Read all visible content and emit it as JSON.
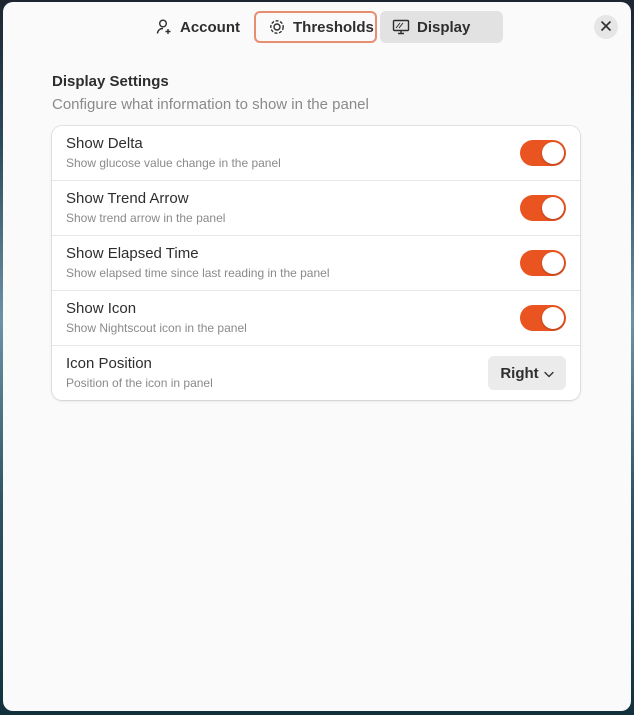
{
  "header": {
    "tabs": [
      {
        "label": "Account",
        "icon": "person-icon"
      },
      {
        "label": "Thresholds",
        "icon": "gear-icon"
      },
      {
        "label": "Display",
        "icon": "monitor-icon"
      }
    ],
    "selected_tab": "Display",
    "close_icon": "close-icon"
  },
  "section": {
    "title": "Display Settings",
    "description": "Configure what information to show in the panel"
  },
  "rows": [
    {
      "title": "Show Delta",
      "subtitle": "Show glucose value change in the panel",
      "enabled": true
    },
    {
      "title": "Show Trend Arrow",
      "subtitle": "Show trend arrow in the panel",
      "enabled": true
    },
    {
      "title": "Show Elapsed Time",
      "subtitle": "Show elapsed time since last reading in the panel",
      "enabled": true
    },
    {
      "title": "Show Icon",
      "subtitle": "Show Nightscout icon in the panel",
      "enabled": true
    },
    {
      "title": "Icon Position",
      "subtitle": "Position of the icon in panel",
      "value": "Right"
    }
  ],
  "colors": {
    "accent": "#e95420",
    "focus_outline": "#e88e70",
    "window_bg": "#fafafa",
    "card_bg": "#ffffff"
  }
}
